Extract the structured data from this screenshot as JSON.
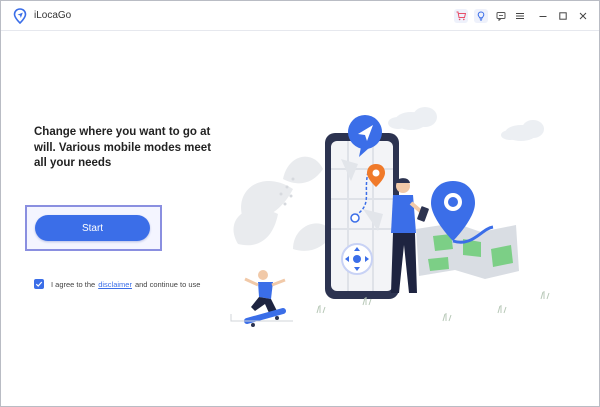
{
  "app": {
    "title": "iLocaGo"
  },
  "titlebar": {
    "buttons": [
      {
        "name": "cart-button",
        "icon": "cart-icon"
      },
      {
        "name": "bulb-button",
        "icon": "lightbulb-icon"
      },
      {
        "name": "feedback-button",
        "icon": "feedback-icon"
      },
      {
        "name": "menu-button",
        "icon": "hamburger-menu-icon"
      },
      {
        "name": "minimize-button",
        "icon": "minimize-icon"
      },
      {
        "name": "maximize-button",
        "icon": "maximize-icon"
      },
      {
        "name": "close-button",
        "icon": "close-icon"
      }
    ]
  },
  "main": {
    "headline": "Change where you want to go at will. Various mobile modes meet all your needs",
    "start_label": "Start",
    "agreement": {
      "checked": true,
      "prefix": "I agree to the",
      "link_text": "disclaimer",
      "suffix": "and continue to use"
    }
  },
  "colors": {
    "accent": "#3b6ee8",
    "cart": "#e8506a",
    "highlight_frame": "#8a8fe0",
    "map_green": "#7ccf86",
    "pin_orange": "#f07a2a"
  }
}
